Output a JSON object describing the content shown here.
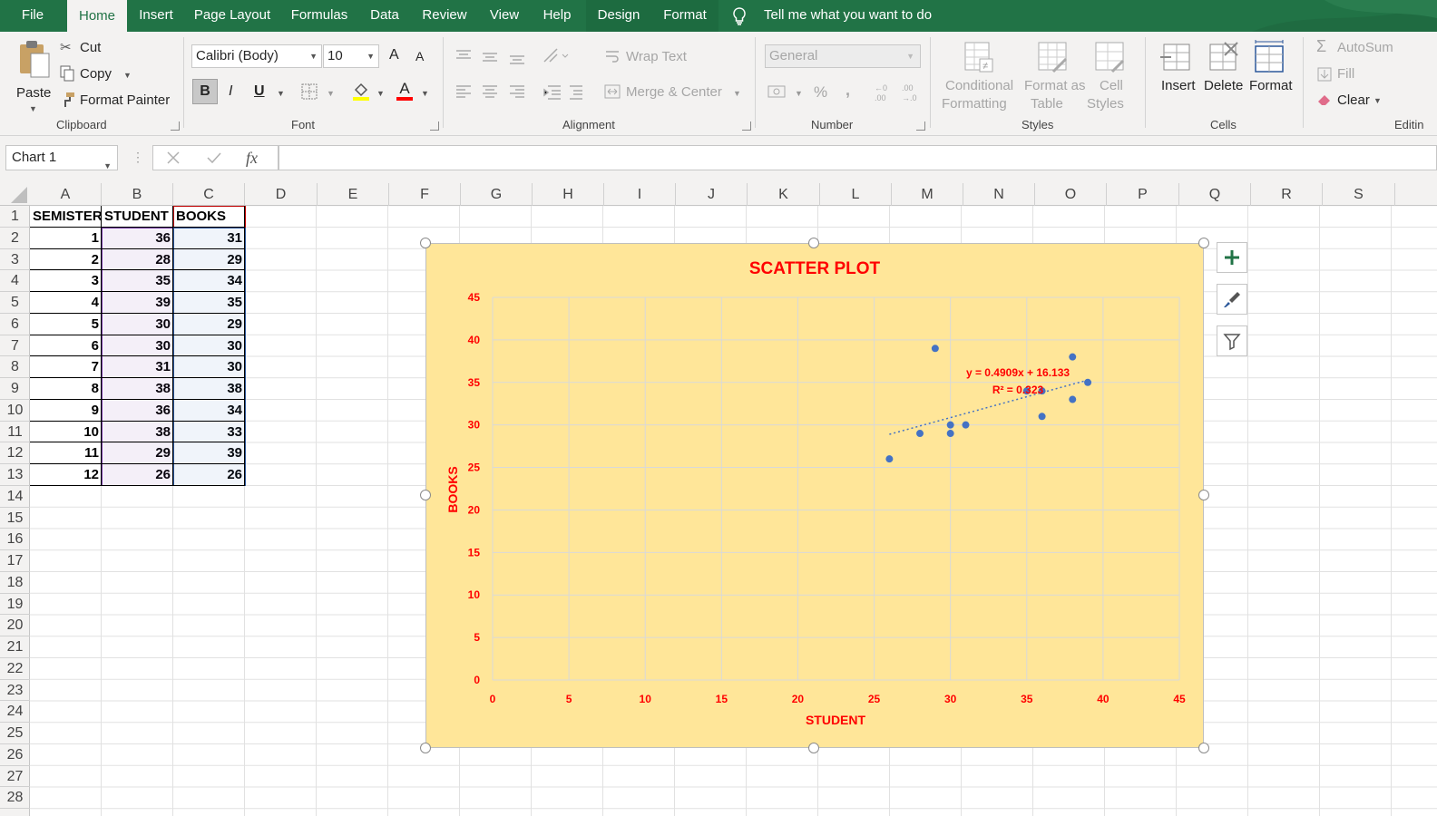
{
  "ribbon_tabs": [
    {
      "label": "File",
      "active": false
    },
    {
      "label": "Home",
      "active": true
    },
    {
      "label": "Insert",
      "active": false
    },
    {
      "label": "Page Layout",
      "active": false
    },
    {
      "label": "Formulas",
      "active": false
    },
    {
      "label": "Data",
      "active": false
    },
    {
      "label": "Review",
      "active": false
    },
    {
      "label": "View",
      "active": false
    },
    {
      "label": "Help",
      "active": false
    },
    {
      "label": "Design",
      "active": false,
      "contextual": true
    },
    {
      "label": "Format",
      "active": false,
      "contextual": true
    }
  ],
  "tell_me": "Tell me what you want to do",
  "clipboard": {
    "paste": "Paste",
    "cut": "Cut",
    "copy": "Copy",
    "format_painter": "Format Painter",
    "group": "Clipboard"
  },
  "font": {
    "name": "Calibri (Body)",
    "size": "10",
    "bold": "B",
    "italic": "I",
    "underline": "U",
    "group": "Font",
    "grow": "A",
    "shrink": "A",
    "font_color_letter": "A"
  },
  "alignment": {
    "wrap_text": "Wrap Text",
    "merge_center": "Merge & Center",
    "group": "Alignment"
  },
  "number": {
    "format": "General",
    "group": "Number",
    "percent": "%",
    "comma": ","
  },
  "styles": {
    "conditional_l1": "Conditional",
    "conditional_l2": "Formatting",
    "format_table_l1": "Format as",
    "format_table_l2": "Table",
    "cell_styles_l1": "Cell",
    "cell_styles_l2": "Styles",
    "group": "Styles"
  },
  "cells": {
    "insert": "Insert",
    "delete": "Delete",
    "format": "Format",
    "group": "Cells"
  },
  "editing": {
    "autosum": "AutoSum",
    "fill": "Fill",
    "clear": "Clear",
    "group": "Editin"
  },
  "name_box": "Chart 1",
  "fx_label": "fx",
  "columns": [
    "A",
    "B",
    "C",
    "D",
    "E",
    "F",
    "G",
    "H",
    "I",
    "J",
    "K",
    "L",
    "M",
    "N",
    "O",
    "P",
    "Q",
    "R",
    "S"
  ],
  "rows": [
    "1",
    "2",
    "3",
    "4",
    "5",
    "6",
    "7",
    "8",
    "9",
    "10",
    "11",
    "12",
    "13",
    "14",
    "15",
    "16",
    "17",
    "18",
    "19",
    "20",
    "21",
    "22",
    "23",
    "24",
    "25",
    "26",
    "27",
    "28"
  ],
  "table": {
    "headers": [
      "SEMISTER",
      "STUDENT",
      "BOOKS"
    ],
    "rows": [
      [
        "1",
        "36",
        "31"
      ],
      [
        "2",
        "28",
        "29"
      ],
      [
        "3",
        "35",
        "34"
      ],
      [
        "4",
        "39",
        "35"
      ],
      [
        "5",
        "30",
        "29"
      ],
      [
        "6",
        "30",
        "30"
      ],
      [
        "7",
        "31",
        "30"
      ],
      [
        "8",
        "38",
        "38"
      ],
      [
        "9",
        "36",
        "34"
      ],
      [
        "10",
        "38",
        "33"
      ],
      [
        "11",
        "29",
        "39"
      ],
      [
        "12",
        "26",
        "26"
      ]
    ]
  },
  "colors": {
    "excel_green": "#217346",
    "chart_bg": "#ffe699",
    "title_red": "#ff0000",
    "point_blue": "#4472c4",
    "trend": "#4472c4"
  },
  "chart_data": {
    "type": "scatter",
    "title": "SCATTER PLOT",
    "xlabel": "STUDENT",
    "ylabel": "BOOKS",
    "xlim": [
      0,
      45
    ],
    "ylim": [
      0,
      45
    ],
    "xticks": [
      0,
      5,
      10,
      15,
      20,
      25,
      30,
      35,
      40,
      45
    ],
    "yticks": [
      0,
      5,
      10,
      15,
      20,
      25,
      30,
      35,
      40,
      45
    ],
    "grid": true,
    "series": [
      {
        "x": [
          36,
          28,
          35,
          39,
          30,
          30,
          31,
          38,
          36,
          38,
          29,
          26
        ],
        "y": [
          31,
          29,
          34,
          35,
          29,
          30,
          30,
          38,
          34,
          33,
          39,
          26
        ]
      }
    ],
    "trendline": {
      "slope": 0.4909,
      "intercept": 16.133,
      "x_range": [
        26,
        39
      ],
      "equation": "y = 0.4909x + 16.133",
      "r2": "R² = 0.323"
    }
  }
}
